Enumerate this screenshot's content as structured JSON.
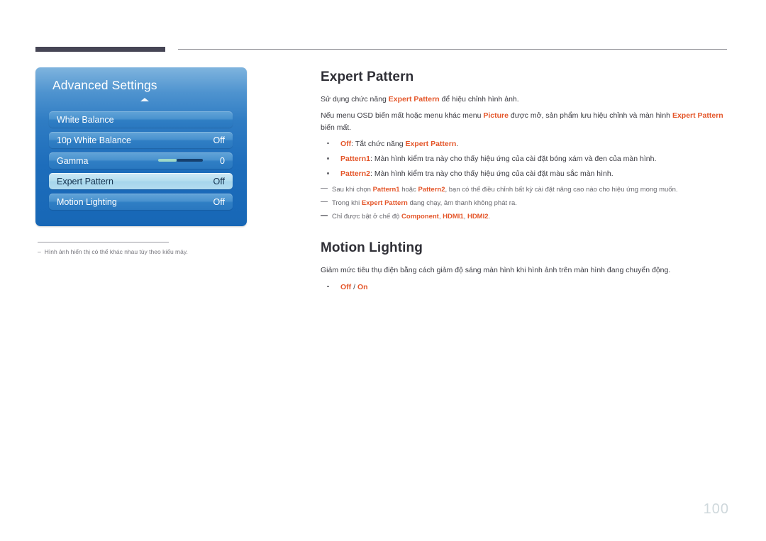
{
  "header": {
    "rule_left_color": "#464555",
    "rule_right_color": "#8f8f95"
  },
  "osd": {
    "title": "Advanced Settings",
    "collapse_icon": "chevron-up-icon",
    "rows": [
      {
        "label": "White Balance",
        "value": "",
        "selected": false,
        "type": "submenu"
      },
      {
        "label": "10p White Balance",
        "value": "Off",
        "selected": false,
        "type": "toggle"
      },
      {
        "label": "Gamma",
        "value": "0",
        "selected": false,
        "type": "slider",
        "slider_left_color": "#9fd9c8",
        "slider_right_color": "#16406e"
      },
      {
        "label": "Expert Pattern",
        "value": "Off",
        "selected": true,
        "type": "toggle"
      },
      {
        "label": "Motion Lighting",
        "value": "Off",
        "selected": false,
        "type": "toggle"
      }
    ],
    "footnote": {
      "dash": "–",
      "text": "Hình ảnh hiển thị có thể khác nhau tùy theo kiểu máy."
    }
  },
  "content": {
    "accent_color": "#e4562a",
    "sections": [
      {
        "title": "Expert Pattern",
        "paragraphs": [
          [
            {
              "t": "Sử dụng chức năng "
            },
            {
              "t": "Expert Pattern",
              "kw": true
            },
            {
              "t": " để hiệu chỉnh hình ảnh."
            }
          ],
          [
            {
              "t": "Nếu menu OSD biến mất hoặc menu khác menu "
            },
            {
              "t": "Picture",
              "kw": true
            },
            {
              "t": " được mở, sản phẩm lưu hiệu chỉnh và màn hình "
            },
            {
              "t": "Expert Pattern",
              "kw": true
            },
            {
              "t": " biến mất."
            }
          ]
        ],
        "bullets": [
          [
            {
              "t": "Off",
              "kw": true
            },
            {
              "t": ": Tắt chức năng "
            },
            {
              "t": "Expert Pattern",
              "kw": true
            },
            {
              "t": "."
            }
          ],
          [
            {
              "t": "Pattern1",
              "kw": true
            },
            {
              "t": ": Màn hình kiểm tra này cho thấy hiệu ứng của cài đặt bóng xám và đen của màn hình."
            }
          ],
          [
            {
              "t": "Pattern2",
              "kw": true
            },
            {
              "t": ": Màn hình kiểm tra này cho thấy hiệu ứng của cài đặt màu sắc màn hình."
            }
          ]
        ],
        "notes": [
          [
            {
              "t": "Sau khi chọn "
            },
            {
              "t": "Pattern1",
              "kw": true
            },
            {
              "t": " hoặc "
            },
            {
              "t": "Pattern2",
              "kw": true
            },
            {
              "t": ", bạn có thể điều chỉnh bất kỳ cài đặt nâng cao nào cho hiệu ứng mong muốn."
            }
          ],
          [
            {
              "t": "Trong khi "
            },
            {
              "t": "Expert Pattern",
              "kw": true
            },
            {
              "t": " đang chạy, âm thanh không phát ra."
            }
          ],
          [
            {
              "t": "Chỉ được bật ở chế độ "
            },
            {
              "t": "Component",
              "kw": true
            },
            {
              "t": ", "
            },
            {
              "t": "HDMI1",
              "kw": true
            },
            {
              "t": ", "
            },
            {
              "t": "HDMI2",
              "kw": true
            },
            {
              "t": "."
            }
          ]
        ]
      },
      {
        "title": "Motion Lighting",
        "paragraphs": [
          [
            {
              "t": "Giảm mức tiêu thụ điện bằng cách giảm độ sáng màn hình khi hình ảnh trên màn hình đang chuyển động."
            }
          ]
        ],
        "bullets": [
          [
            {
              "t": "Off",
              "kw": true
            },
            {
              "t": " / "
            },
            {
              "t": "On",
              "kw": true
            }
          ]
        ],
        "notes": []
      }
    ]
  },
  "footer": {
    "page_number": "100"
  }
}
